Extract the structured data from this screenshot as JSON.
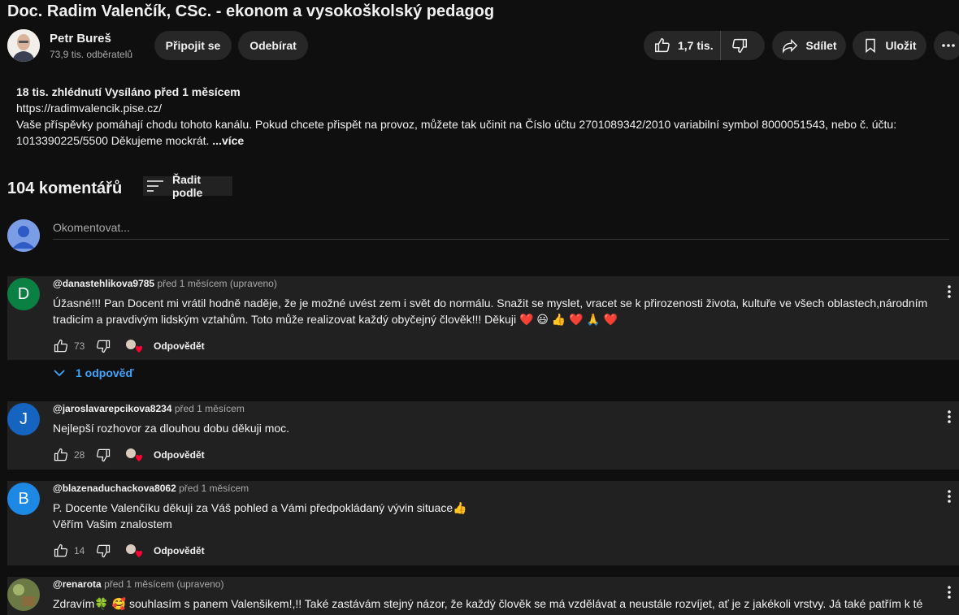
{
  "video": {
    "title": "Doc. Radim Valenčík, CSc. - ekonom a vysokoškolský pedagog"
  },
  "channel": {
    "name": "Petr Bureš",
    "subscribers": "73,9 tis. odběratelů",
    "join_label": "Připojit se",
    "subscribe_label": "Odebírat"
  },
  "actions": {
    "likes": "1,7 tis.",
    "share_label": "Sdílet",
    "save_label": "Uložit"
  },
  "description": {
    "meta": "18 tis. zhlédnutí  Vysíláno před 1 měsícem",
    "line1": "https://radimvalencik.pise.cz/",
    "line2": "Vaše příspěvky pomáhají chodu tohoto kanálu. Pokud chcete přispět na provoz, můžete tak učinit na Číslo účtu 2701089342/2010 variabilní symbol 8000051543, nebo č. účtu:",
    "line3": "1013390225/5500 Děkujeme mockrát.",
    "more_label": "...více"
  },
  "comments_header": {
    "count": "104 komentářů",
    "sort_label": "Řadit podle"
  },
  "comment_box": {
    "placeholder": "Okomentovat..."
  },
  "reply_label": "Odpovědět",
  "replies_toggle": "1 odpověď",
  "comments": [
    {
      "initial": "D",
      "avatar_color": "#0b8043",
      "handle": "@danastehlikova9785",
      "time": "před 1 měsícem (upraveno)",
      "text": "Úžasné!!! Pan Docent mi vrátil hodně naděje, že  je možné uvést zem i svět do normálu. Snažit se myslet, vracet se k přirozenosti života, kultuře ve všech oblastech,národním\ntradicím a  pravdivým lidským vztahům. Toto může realizovat každý obyčejný člověk!!! Děkuji ❤️ 😃 👍 ❤️ 🙏 ❤️",
      "likes": "73"
    },
    {
      "initial": "J",
      "avatar_color": "#1565c0",
      "handle": "@jaroslavarepcikova8234",
      "time": "před 1 měsícem",
      "text": "Nejlepší rozhovor za dlouhou dobu děkuji moc.",
      "likes": "28"
    },
    {
      "initial": "B",
      "avatar_color": "#1e88e5",
      "handle": "@blazenaduchackova8062",
      "time": "před 1 měsícem",
      "text": "P. Docente Valenčíku děkuji za Váš pohled a Vámi předpokládaný vývin situace👍\nVěřím Vašim znalostem",
      "likes": "14"
    },
    {
      "initial": "",
      "avatar_color": "#5b6b3a",
      "handle": "@renarota",
      "time": "před 1 měsícem (upraveno)",
      "text": "Zdravím🍀 🥰 souhlasím s panem Valenšikem!,!! Také zastávám stejný názor, že každý člověk  se má vzdělávat a neustále rozvíjet, ať je z jakékoli vrstvy. Já také patřím k té",
      "likes": ""
    }
  ]
}
